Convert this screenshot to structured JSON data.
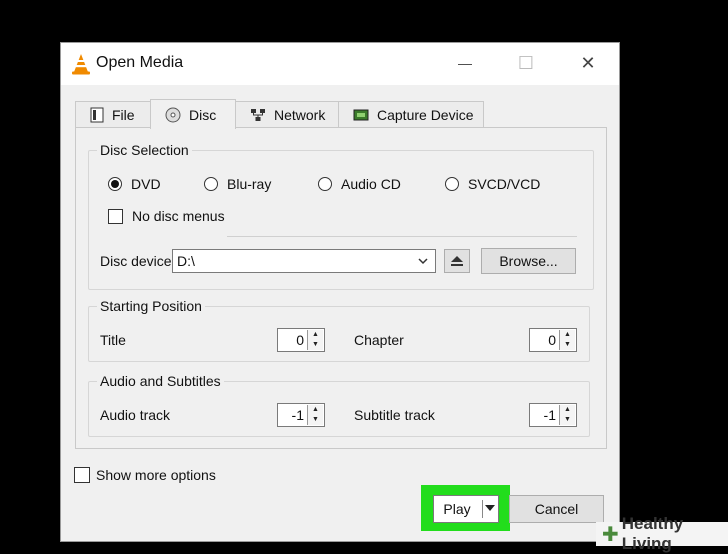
{
  "window": {
    "title": "Open Media",
    "minimize": "—",
    "maximize": "☐",
    "close": "✕"
  },
  "tabs": [
    {
      "label": "File",
      "icon": "file-icon"
    },
    {
      "label": "Disc",
      "icon": "disc-icon",
      "active": true
    },
    {
      "label": "Network",
      "icon": "network-icon"
    },
    {
      "label": "Capture Device",
      "icon": "capture-device-icon"
    }
  ],
  "disc_selection": {
    "title": "Disc Selection",
    "options": [
      {
        "label": "DVD",
        "selected": true
      },
      {
        "label": "Blu-ray",
        "selected": false
      },
      {
        "label": "Audio CD",
        "selected": false
      },
      {
        "label": "SVCD/VCD",
        "selected": false
      }
    ],
    "no_disc_menus": {
      "label": "No disc menus",
      "checked": false
    },
    "device_label": "Disc device",
    "device_value": "D:\\",
    "browse_label": "Browse..."
  },
  "starting_position": {
    "title": "Starting Position",
    "title_label": "Title",
    "title_value": "0",
    "chapter_label": "Chapter",
    "chapter_value": "0"
  },
  "audio_subtitles": {
    "title": "Audio and Subtitles",
    "audio_label": "Audio track",
    "audio_value": "-1",
    "subtitle_label": "Subtitle track",
    "subtitle_value": "-1"
  },
  "show_more": {
    "label": "Show more options",
    "checked": false
  },
  "buttons": {
    "play": "Play",
    "cancel": "Cancel"
  },
  "watermark": {
    "plus": "✚",
    "text": "Healthy Living"
  },
  "colors": {
    "highlight": "#22dd1c",
    "vlc_orange": "#f08a00"
  }
}
